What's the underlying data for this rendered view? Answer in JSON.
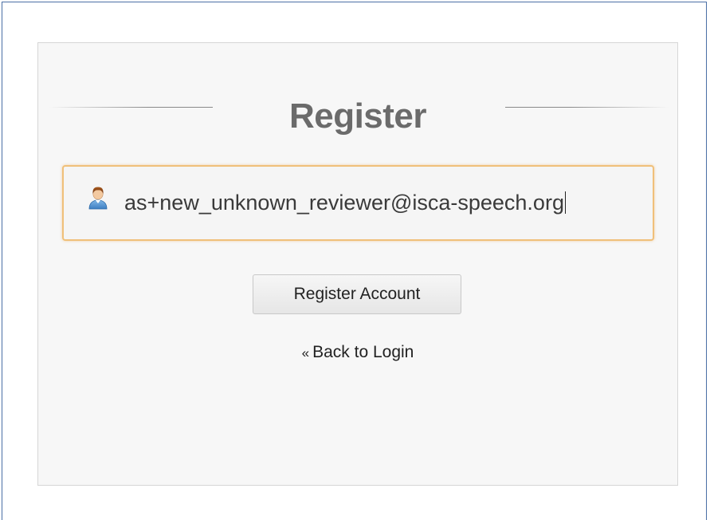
{
  "register": {
    "title": "Register",
    "email_value": "as+new_unknown_reviewer@isca-speech.org",
    "email_icon": "user-icon",
    "submit_label": "Register Account",
    "back_glyph": "«",
    "back_label": "Back to Login"
  },
  "colors": {
    "input_focus_border": "#f0c07a",
    "panel_background": "#f7f7f7",
    "title_text": "#6b6b6b"
  }
}
